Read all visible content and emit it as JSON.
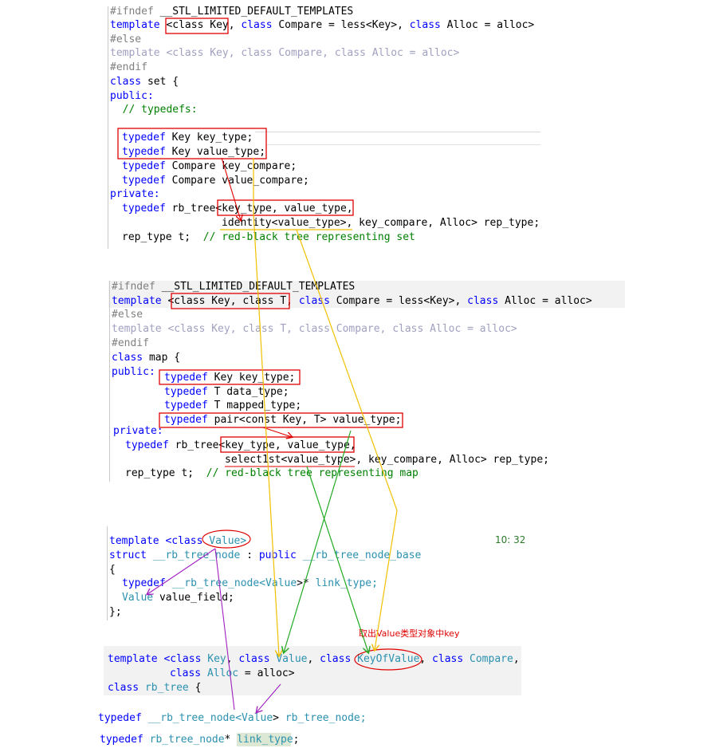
{
  "block1": {
    "l1_pp": "#ifndef",
    "l1_macro": " __STL_LIMITED_DEFAULT_TEMPLATES",
    "l2_template": "template ",
    "l2_ck": "<class Key",
    "l2_rest1": ", ",
    "l2_class2": "class",
    "l2_rest2": " Compare = less<Key>, ",
    "l2_class3": "class",
    "l2_rest3": " Alloc = alloc>",
    "l3": "#else",
    "l4": "template <class Key, class Compare, class Alloc = alloc>",
    "l5": "#endif",
    "l6_class": "class",
    "l6_rest": " set {",
    "l7": "public:",
    "l8": "  // typedefs:",
    "l9_td": "typedef",
    "l9_rest": " Key key_type;",
    "l10_td": "typedef",
    "l10_rest": " Key value_type;",
    "l11_td": "typedef",
    "l11_rest": " Compare key_compare;",
    "l12_td": "typedef",
    "l12_rest": " Compare value_compare;",
    "l13": "private:",
    "l14_td": "typedef",
    "l14_rest": " rb_tree<key_type, value_type,",
    "l15": "identity<value_type>, key_compare, Alloc> rep_type;",
    "l16_code": "rep_type t;  ",
    "l16_cm": "// red-black tree representing set"
  },
  "block2": {
    "l1_pp": "#ifndef",
    "l1_macro": " __STL_LIMITED_DEFAULT_TEMPLATES",
    "l2_template": "template ",
    "l2_a": "<class Key, class T,",
    "l2_class": " class",
    "l2_b": " Compare = less<Key>, ",
    "l2_class2": "class",
    "l2_c": " Alloc = alloc>",
    "l3": "#else",
    "l4": "template <class Key, class T, class Compare, class Alloc = alloc>",
    "l5": "#endif",
    "l6_class": "class",
    "l6_rest": " map {",
    "l7": "public:",
    "l7_td": "typedef",
    "l7_rest": " Key key_type;",
    "l8_td": "typedef",
    "l8_rest": " T data_type;",
    "l9_td": "typedef",
    "l9_rest": " T mapped_type;",
    "l10_td": "typedef",
    "l10_rest": " pair<const Key, T> value_type;",
    "l11": "private:",
    "l12_td": "typedef",
    "l12_rest": " rb_tree<key_type, value_type,",
    "l13": "select1st<value_type>, key_compare, Alloc> rep_type;",
    "l14_code": "rep_type t;  ",
    "l14_cm": "// red-black tree representing map"
  },
  "block3": {
    "l1_template": "template <",
    "l1_class": "class",
    "l1_value": " Value>",
    "l2_struct": "struct",
    "l2_name": " __rb_tree_node",
    "l2_colon": " : ",
    "l2_public": "public",
    "l2_base": " __rb_tree_node_base",
    "l3": "{",
    "l4_td": "typedef",
    "l4_a": " __rb_tree_node<",
    "l4_v": "Value",
    "l4_b": ">* ",
    "l4_c": "link_type;",
    "l5_v": "Value",
    "l5_rest": " value_field;",
    "l6": "};",
    "time": "10: 32"
  },
  "annotation": "取出Value类型对象中key",
  "block4": {
    "l1_template": "template <",
    "l1_c1": "class",
    "l1_key": " Key",
    "l1_s1": ", ",
    "l1_c2": "class",
    "l1_val": " Value",
    "l1_s2": ", ",
    "l1_c3": "class",
    "l1_kov": " KeyOfValue",
    "l1_s3": ", ",
    "l1_c4": "class",
    "l1_cmp": " Compare",
    "l1_end": ",",
    "l2_c": "class",
    "l2_alloc": " Alloc",
    "l2_rest": " = alloc>",
    "l3_class": "class",
    "l3_name": " rb_tree",
    "l3_rest": " {"
  },
  "block5": {
    "l1_td": "typedef",
    "l1_a": " __rb_tree_node<",
    "l1_v": "Value",
    "l1_b": "> ",
    "l1_c": "rb_tree_node;",
    "l2_td": "typedef",
    "l2_a": " rb_tree_node",
    "l2_b": "* ",
    "l2_c": "link_type",
    "l2_d": ";"
  },
  "colors": {
    "keyword": "#0000ff",
    "type": "#2b91af",
    "comment": "#008000",
    "box": "#e00000",
    "yellow_arrow": "#f0c000",
    "green_arrow": "#22aa22",
    "purple_arrow": "#a020c0"
  }
}
